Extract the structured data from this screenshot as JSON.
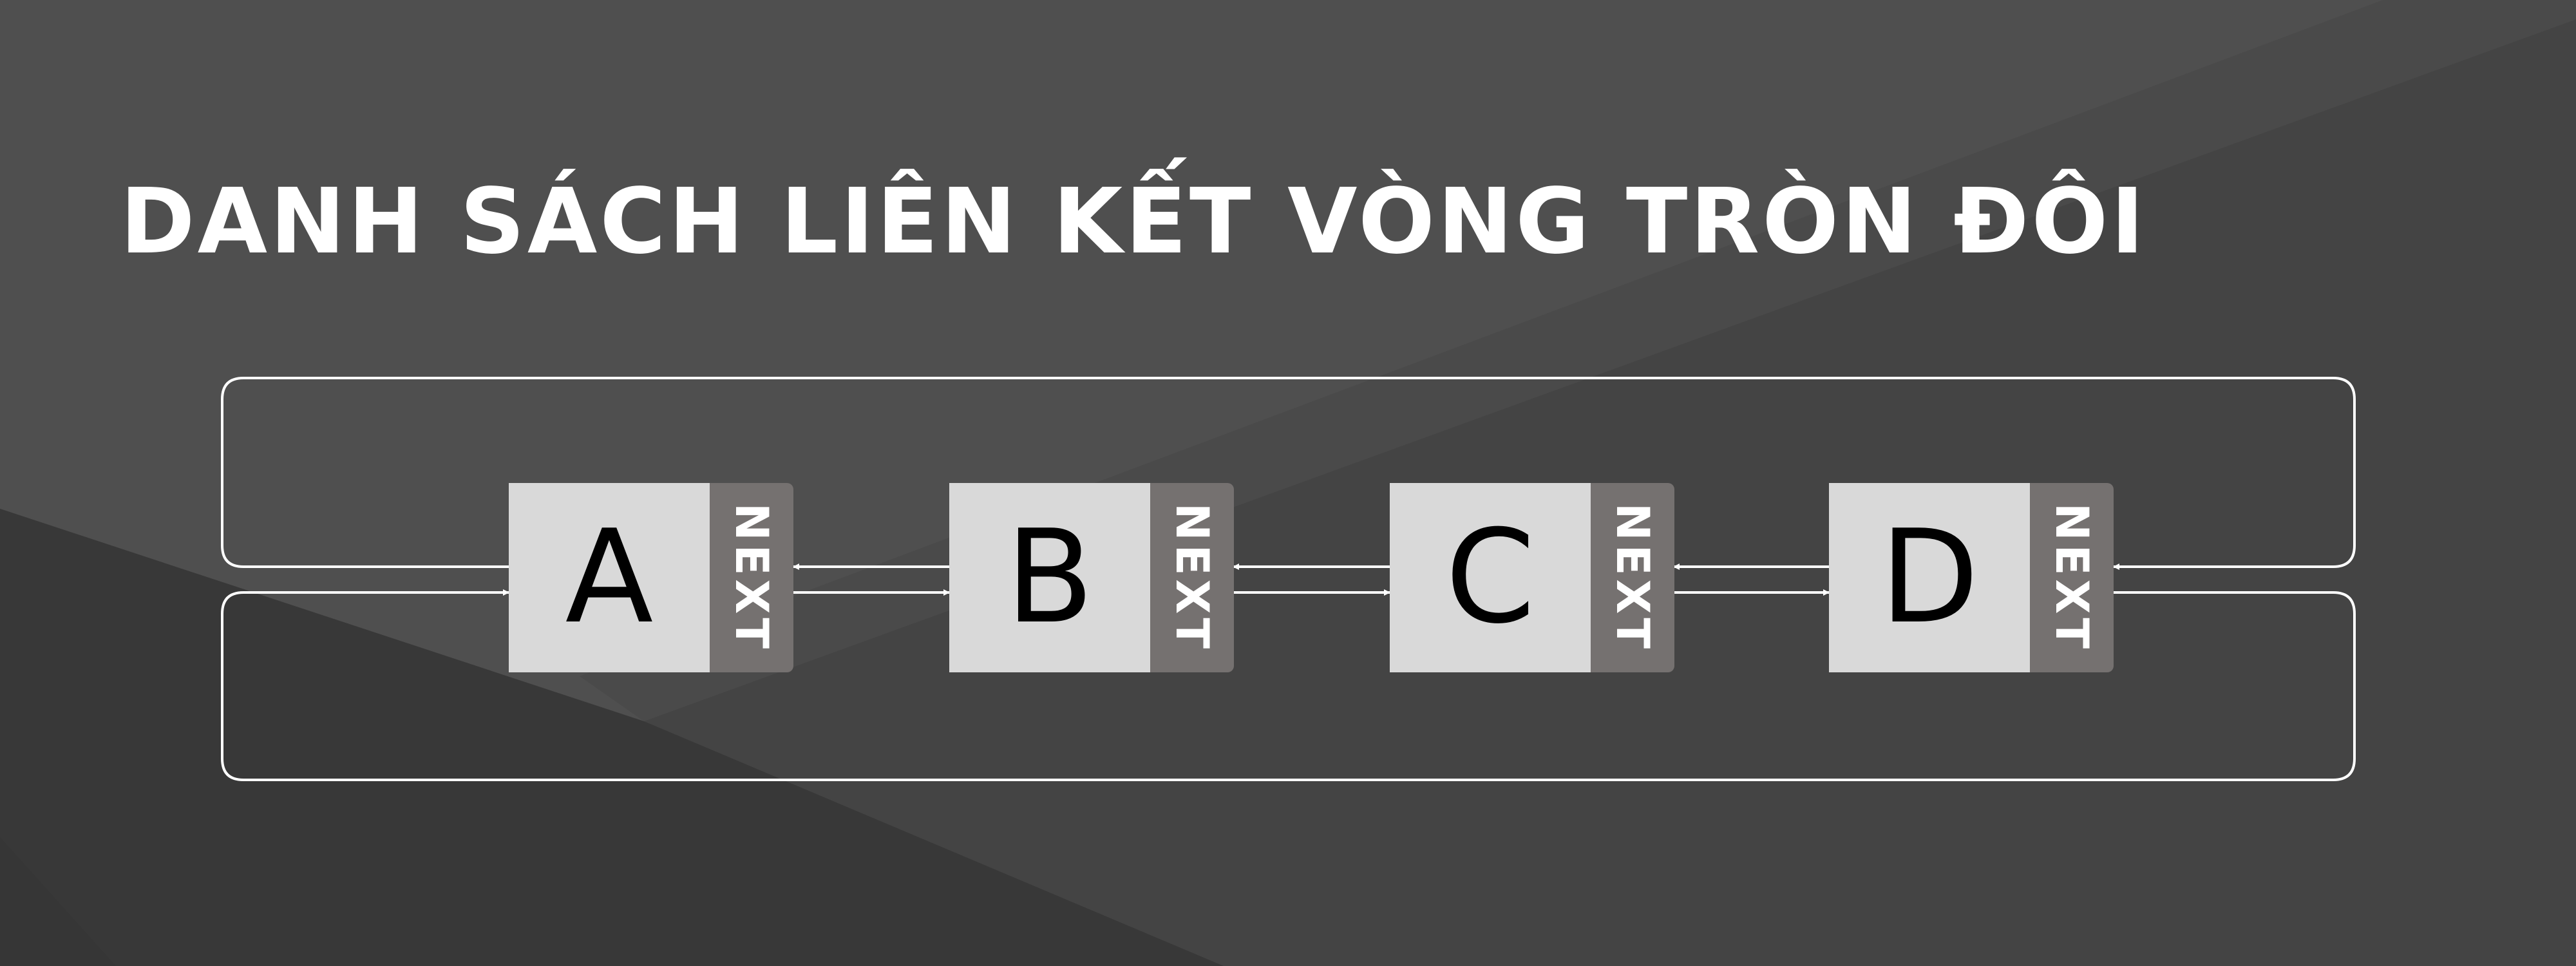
{
  "title": "DANH SÁCH LIÊN KẾT VÒNG TRÒN ĐÔI",
  "nodes": [
    {
      "value": "A",
      "pointer_label": "NEXT"
    },
    {
      "value": "B",
      "pointer_label": "NEXT"
    },
    {
      "value": "C",
      "pointer_label": "NEXT"
    },
    {
      "value": "D",
      "pointer_label": "NEXT"
    }
  ],
  "links": [
    {
      "from": "A",
      "to": "B"
    },
    {
      "from": "B",
      "to": "A"
    },
    {
      "from": "B",
      "to": "C"
    },
    {
      "from": "C",
      "to": "B"
    },
    {
      "from": "C",
      "to": "D"
    },
    {
      "from": "D",
      "to": "C"
    },
    {
      "from": "D",
      "to": "A"
    },
    {
      "from": "A",
      "to": "D"
    }
  ],
  "colors": {
    "background": "#464646",
    "node_data": "#d9d9d9",
    "node_pointer": "#757170",
    "title_text": "#ffffff",
    "wire": "#ffffff"
  }
}
